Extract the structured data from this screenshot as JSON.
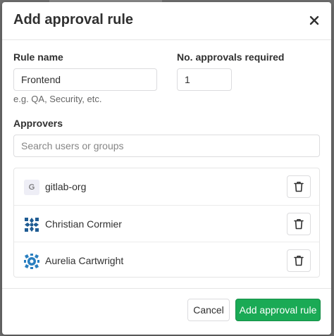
{
  "modal": {
    "title": "Add approval rule",
    "close_label": "×"
  },
  "form": {
    "rule_name_label": "Rule name",
    "rule_name_value": "Frontend",
    "rule_name_help": "e.g. QA, Security, etc.",
    "approvals_label": "No. approvals required",
    "approvals_value": "1",
    "approvers_label": "Approvers",
    "approvers_placeholder": "Search users or groups"
  },
  "approvers": [
    {
      "avatar_letter": "G",
      "name": "gitlab-org",
      "avatar_icon": "group-letter-avatar"
    },
    {
      "name": "Christian Cormier",
      "avatar_icon": "identicon-avatar",
      "avatar_color": "#1f5c93"
    },
    {
      "name": "Aurelia Cartwright",
      "avatar_icon": "identicon-avatar",
      "avatar_color": "#2a7fc0"
    }
  ],
  "footer": {
    "cancel_label": "Cancel",
    "submit_label": "Add approval rule"
  },
  "colors": {
    "primary": "#1aaa55",
    "backdrop": "#6f6f6f"
  }
}
